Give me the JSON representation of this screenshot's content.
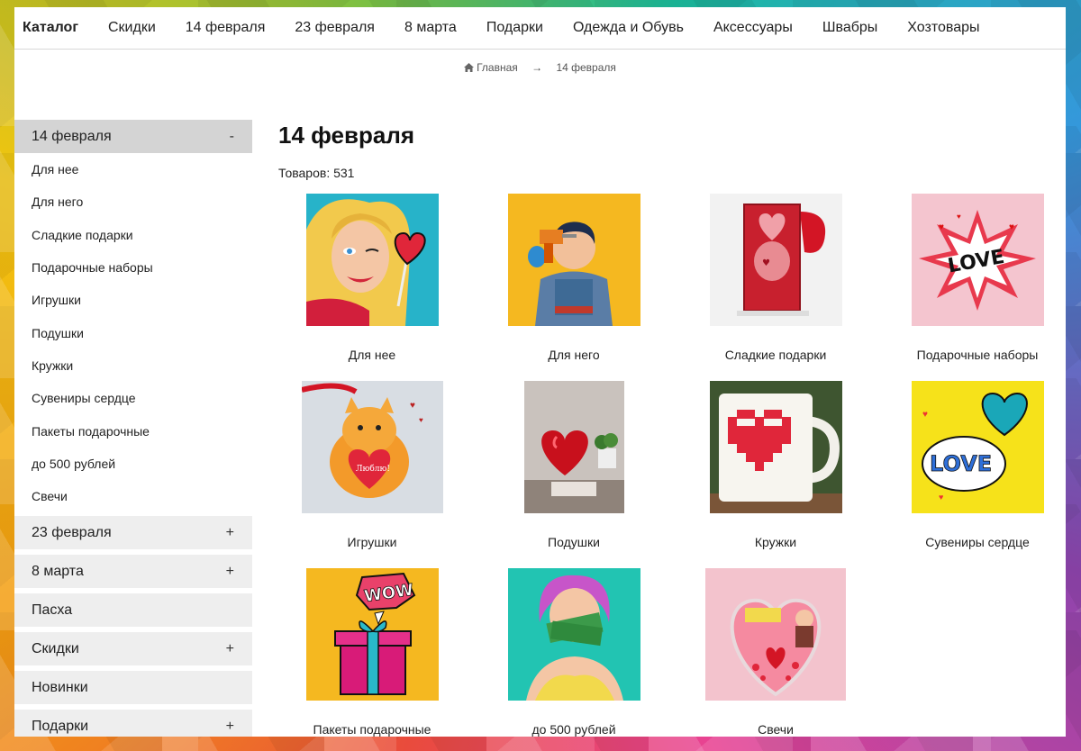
{
  "topnav": {
    "items": [
      "Каталог",
      "Скидки",
      "14 февраля",
      "23 февраля",
      "8 марта",
      "Подарки",
      "Одежда и Обувь",
      "Аксессуары",
      "Швабры",
      "Хозтовары"
    ]
  },
  "breadcrumb": {
    "home": "Главная",
    "arrow": "→",
    "current": "14 февраля"
  },
  "sidebar": {
    "open_section": {
      "label": "14 февраля",
      "toggle": "-"
    },
    "subitems": [
      "Для нее",
      "Для него",
      "Сладкие подарки",
      "Подарочные наборы",
      "Игрушки",
      "Подушки",
      "Кружки",
      "Сувениры сердце",
      "Пакеты подарочные",
      "до 500 рублей",
      "Свечи"
    ],
    "sections": [
      {
        "label": "23 февраля",
        "toggle": "+"
      },
      {
        "label": "8 марта",
        "toggle": "+"
      },
      {
        "label": "Пасха",
        "toggle": ""
      },
      {
        "label": "Скидки",
        "toggle": "+"
      },
      {
        "label": "Новинки",
        "toggle": ""
      },
      {
        "label": "Подарки",
        "toggle": "+"
      }
    ]
  },
  "main": {
    "title": "14 февраля",
    "count": "Товаров: 531"
  },
  "products": [
    {
      "label": "Для нее",
      "image": "pop-art-woman-heart-lollipop"
    },
    {
      "label": "Для него",
      "image": "pop-art-man-drill"
    },
    {
      "label": "Сладкие подарки",
      "image": "red-gift-box"
    },
    {
      "label": "Подарочные наборы",
      "image": "love-comic-burst"
    },
    {
      "label": "Игрушки",
      "image": "plush-cat-heart"
    },
    {
      "label": "Подушки",
      "image": "red-heart-pillow"
    },
    {
      "label": "Кружки",
      "image": "pixel-heart-mug"
    },
    {
      "label": "Сувениры сердце",
      "image": "love-cloud-heart"
    },
    {
      "label": "Пакеты подарочные",
      "image": "wow-gift-box"
    },
    {
      "label": "до 500 рублей",
      "image": "pop-art-woman-money"
    },
    {
      "label": "Свечи",
      "image": "heart-candle-box"
    }
  ],
  "colors": {
    "active_section_bg": "#d4d4d4",
    "section_bg": "#eeeeee",
    "heart_red": "#e0263a"
  }
}
